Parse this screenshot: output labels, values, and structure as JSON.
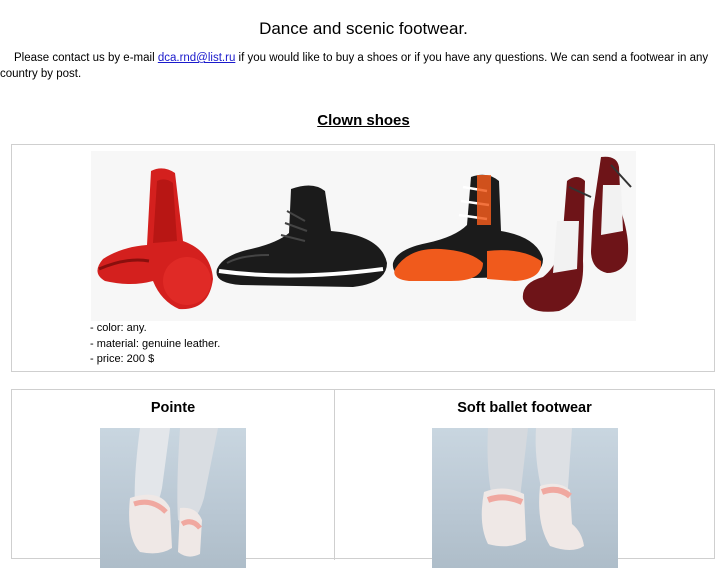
{
  "header": {
    "title": "Dance and scenic footwear."
  },
  "intro": {
    "before_link": "Please contact us by e-mail ",
    "email": "dca.rnd@list.ru",
    "after_link": " if you would like to buy a shoes or if you have any questions. We can send a footwear in any country by post."
  },
  "clown": {
    "heading": "Clown shoes",
    "image_label": "clown-shoes-photo",
    "specs": [
      "- color: any.",
      "- material: genuine leather.",
      "- price: 200 $"
    ]
  },
  "products": [
    {
      "title": "Pointe"
    },
    {
      "title": "Soft ballet footwear"
    }
  ],
  "colors": {
    "link": "#1a1acc",
    "border": "#cfcfcf",
    "shoe_red": "#d4201e",
    "shoe_black": "#1b1b1b",
    "shoe_orange": "#f05a1c",
    "shoe_maroon": "#6e1418",
    "ribbon_pink": "#f0a8a0"
  }
}
